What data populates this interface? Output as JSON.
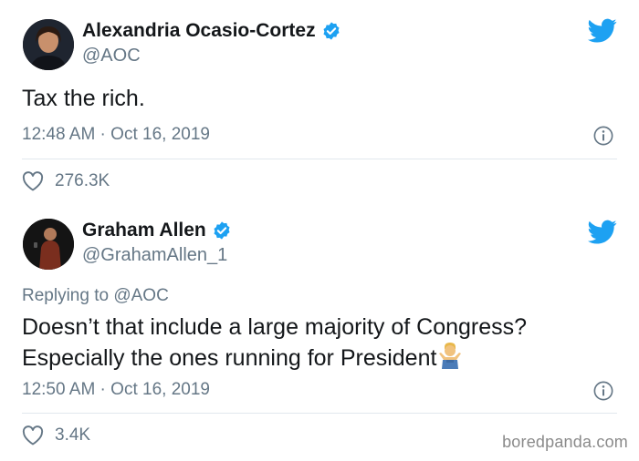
{
  "tweets": [
    {
      "display_name": "Alexandria Ocasio-Cortez",
      "handle": "@AOC",
      "text_lines": [
        "Tax the rich."
      ],
      "timestamp": "12:48 AM · Oct 16, 2019",
      "likes": "276.3K"
    },
    {
      "display_name": "Graham Allen",
      "handle": "@GrahamAllen_1",
      "reply_prefix": "Replying to ",
      "reply_mention": "@AOC",
      "text_lines": [
        "Doesn’t that include a large majority of Congress?",
        "Especially the ones running for President"
      ],
      "timestamp": "12:50 AM · Oct 16, 2019",
      "likes": "3.4K"
    }
  ],
  "watermark": "boredpanda.com",
  "colors": {
    "twitter_blue": "#1da1f2",
    "text_primary": "#14171a",
    "text_secondary": "#657786",
    "divider": "#e1e8ed"
  },
  "icons": [
    "verified-badge-icon",
    "twitter-bird-icon",
    "info-icon",
    "heart-icon",
    "man-shrugging-emoji"
  ]
}
